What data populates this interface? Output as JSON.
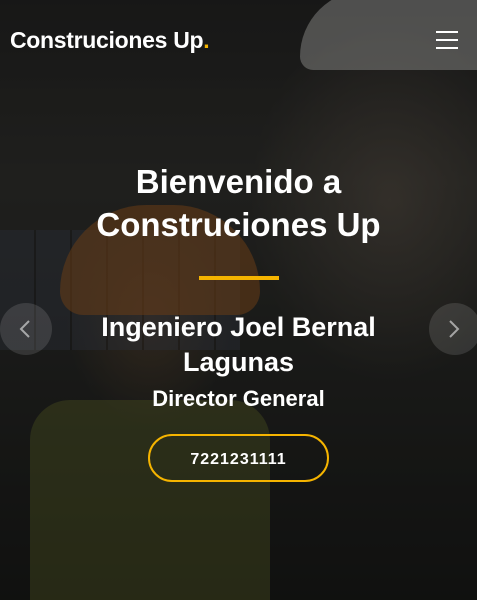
{
  "header": {
    "brand": "Construciones Up",
    "brand_dot": ".",
    "menu_icon": "hamburger-menu-icon"
  },
  "hero": {
    "title": "Bienvenido a Construciones Up",
    "name": "Ingeniero Joel Bernal Lagunas",
    "role": "Director General",
    "phone": "7221231111",
    "accent_color": "#f5b400",
    "prev_icon": "chevron-left-icon",
    "next_icon": "chevron-right-icon"
  }
}
